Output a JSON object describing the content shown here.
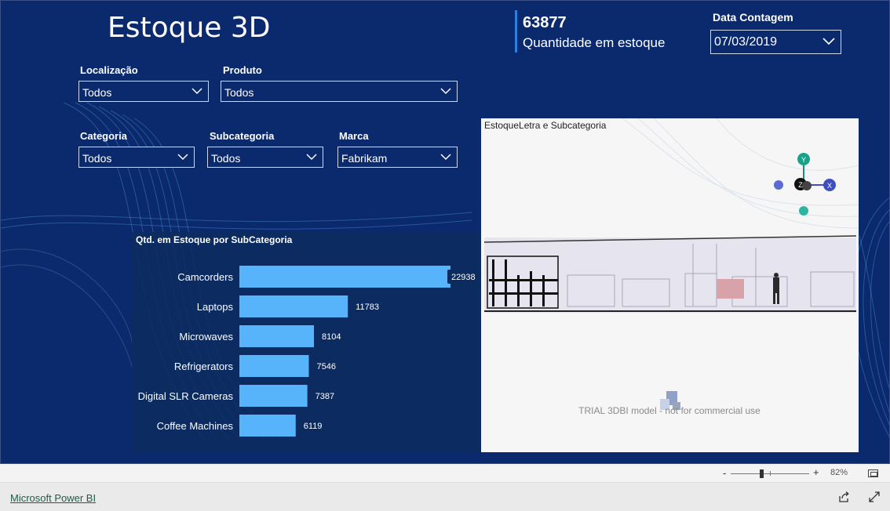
{
  "report": {
    "title": "Estoque 3D",
    "kpi": {
      "value": "63877",
      "label": "Quantidade em estoque"
    },
    "date_slicer": {
      "label": "Data Contagem",
      "value": "07/03/2019"
    },
    "slicers": [
      {
        "label": "Localização",
        "value": "Todos"
      },
      {
        "label": "Produto",
        "value": "Todos"
      },
      {
        "label": "Categoria",
        "value": "Todos"
      },
      {
        "label": "Subcategoria",
        "value": "Todos"
      },
      {
        "label": "Marca",
        "value": "Fabrikam"
      }
    ]
  },
  "chart_data": {
    "type": "bar",
    "title": "Qtd. em Estoque por SubCategoria",
    "orientation": "horizontal",
    "categories": [
      "Camcorders",
      "Laptops",
      "Microwaves",
      "Refrigerators",
      "Digital SLR Cameras",
      "Coffee Machines"
    ],
    "values": [
      22938,
      11783,
      8104,
      7546,
      7387,
      6119
    ],
    "data_labels": [
      "22938",
      "11783",
      "8104",
      "7546",
      "7387",
      "6119"
    ],
    "bar_color": "#57b4fb",
    "xlim": [
      0,
      22938
    ]
  },
  "visual3d": {
    "title": "EstoqueLetra e Subcategoria",
    "gizmo": {
      "y": "Y",
      "x": "X",
      "z": "Z"
    },
    "trial_text": "TRIAL 3DBI model - not for commercial use"
  },
  "zoom": {
    "minus": "-",
    "plus": "+",
    "percent": "82%",
    "value": 82
  },
  "footer": {
    "link": "Microsoft Power BI"
  },
  "icons": {
    "chevron": "chevron-down-icon",
    "share": "share-icon",
    "expand": "expand-icon",
    "fit": "fit-to-page-icon"
  }
}
